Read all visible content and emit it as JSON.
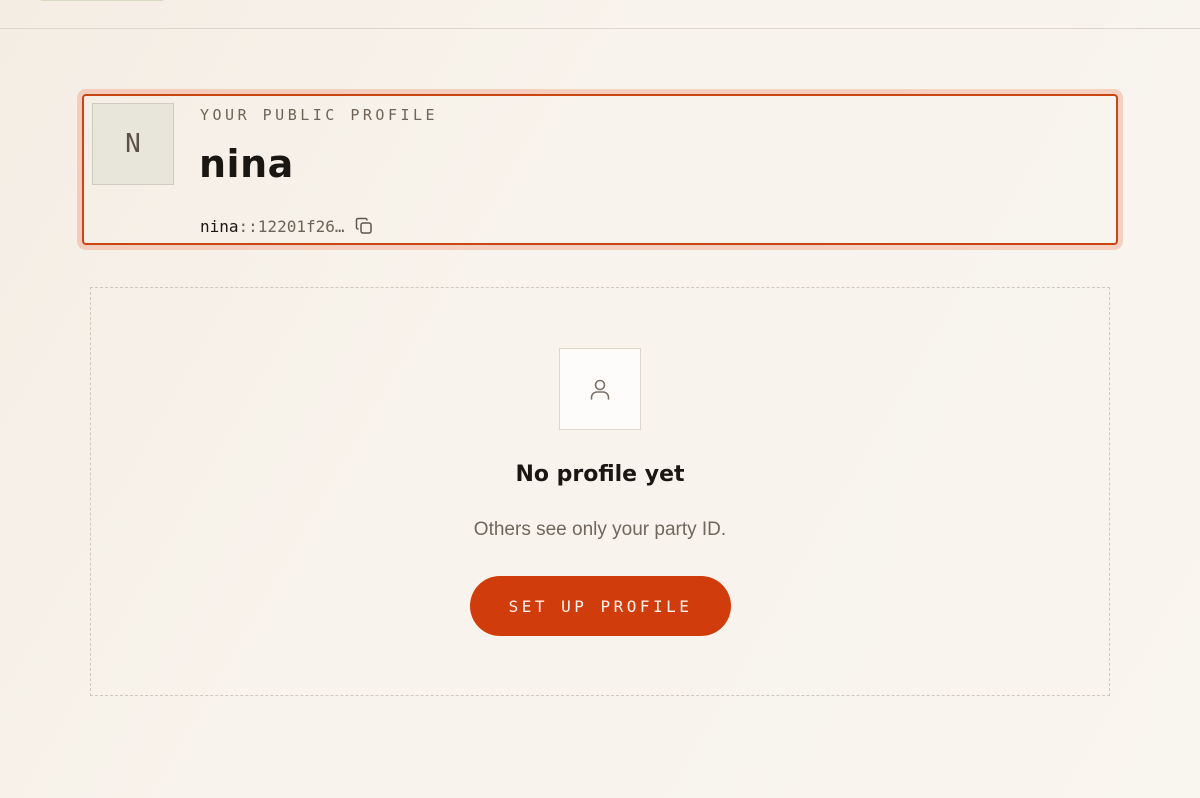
{
  "profile": {
    "avatar_initial": "N",
    "eyebrow": "YOUR PUBLIC PROFILE",
    "name": "nina",
    "party_id_name": "nina",
    "party_id_hash": "::12201f26…",
    "copy_icon": "copy-icon"
  },
  "empty_state": {
    "icon": "user-icon",
    "title": "No profile yet",
    "subtitle": "Others see only your party ID.",
    "button_label": "SET UP PROFILE"
  },
  "colors": {
    "accent": "#d13c0c",
    "highlight_border": "#c94512",
    "background": "#f7f2ea"
  }
}
